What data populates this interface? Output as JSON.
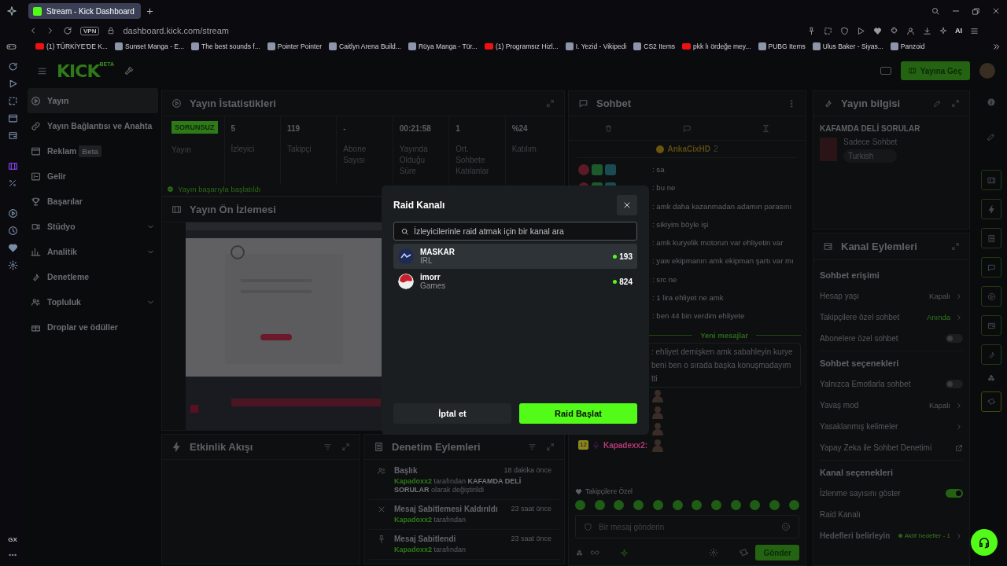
{
  "browser": {
    "tabs": [
      {
        "title": "Stream - Kick Dashboard",
        "selected": true
      }
    ],
    "vpn": "VPN",
    "url": "dashboard.kick.com/stream",
    "ai_label": "AI",
    "bookmarks": [
      {
        "kind": "video",
        "title": "(1) TÜRKİYE'DE K..."
      },
      {
        "kind": "page",
        "title": "Sunset Manga - E..."
      },
      {
        "kind": "page",
        "title": "The best sounds f..."
      },
      {
        "kind": "page",
        "title": "Pointer Pointer"
      },
      {
        "kind": "page",
        "title": "Caitlyn Arena Build..."
      },
      {
        "kind": "page",
        "title": "Rüya Manga - Tür..."
      },
      {
        "kind": "video",
        "title": "(1) Programsız Hizl..."
      },
      {
        "kind": "page",
        "title": "I. Yezid - Vikipedi"
      },
      {
        "kind": "page",
        "title": "CS2 Items"
      },
      {
        "kind": "video",
        "title": "pkk lı ördeğe mey..."
      },
      {
        "kind": "page",
        "title": "PUBG Items"
      },
      {
        "kind": "page",
        "title": "Ulus Baker - Siyas..."
      },
      {
        "kind": "page",
        "title": "Panzoid"
      }
    ],
    "gx_label": "GX"
  },
  "header": {
    "logo": "KICK",
    "logo_badge": "BETA",
    "go_live": "Yayına Geç"
  },
  "nav": {
    "items": [
      {
        "label": "Yayın",
        "selected": true,
        "expandable": false
      },
      {
        "label": "Yayın Bağlantısı ve Anahta",
        "selected": false,
        "expandable": false
      },
      {
        "label": "Reklam",
        "badge": "Beta",
        "selected": false,
        "expandable": false
      },
      {
        "label": "Gelir",
        "selected": false,
        "expandable": false
      },
      {
        "label": "Başarılar",
        "selected": false,
        "expandable": false
      },
      {
        "label": "Stüdyo",
        "selected": false,
        "expandable": true
      },
      {
        "label": "Analitik",
        "selected": false,
        "expandable": true
      },
      {
        "label": "Denetleme",
        "selected": false,
        "expandable": false
      },
      {
        "label": "Topluluk",
        "selected": false,
        "expandable": true
      },
      {
        "label": "Droplar ve ödüller",
        "selected": false,
        "expandable": false
      }
    ]
  },
  "stats": {
    "title": "Yayın İstatistikleri",
    "status": "SORUNSUZ",
    "status_label": "Yayın",
    "items": [
      {
        "value": "5",
        "label": "İzleyici"
      },
      {
        "value": "119",
        "label": "Takipçi"
      },
      {
        "value": "-",
        "label": "Abone Sayısı"
      },
      {
        "value": "00:21:58",
        "label": "Yayında Olduğu Süre"
      },
      {
        "value": "1",
        "label": "Ort. Sohbete Katılanlar"
      },
      {
        "value": "%24",
        "label": "Katılım"
      }
    ],
    "notice": "Yayın başarıyla başlatıldı"
  },
  "preview": {
    "title": "Yayın Ön İzlemesi"
  },
  "feed": {
    "title": "Etkinlik Akışı"
  },
  "audit": {
    "title": "Denetim Eylemleri",
    "entries": [
      {
        "title": "Başlık",
        "time": "18 dakika önce",
        "user": "Kapadoxx2",
        "text": "tarafından **KAFAMDA DELİ SORULAR** olarak değiştirildi"
      },
      {
        "title": "Mesaj Sabitlemesi Kaldırıldı",
        "time": "23 saat önce",
        "user": "Kapadoxx2",
        "text": "tarafından"
      },
      {
        "title": "Mesaj Sabitlendi",
        "time": "23 saat önce",
        "user": "Kapadoxx2",
        "text": "tarafından"
      }
    ]
  },
  "chat": {
    "title": "Sohbet",
    "pinned_user": "AnkaCixHD",
    "pinned_count": "2",
    "messages": [
      {
        "text": ": sa",
        "badges": true
      },
      {
        "text": ": bu ne",
        "badges": true
      },
      {
        "text": ": amk daha kazanmadan adamın parasını"
      },
      {
        "text": ": sikiyim böyle işi"
      },
      {
        "text": ": amk kuryelik motorun var ehliyetin var"
      },
      {
        "text": ": yaw ekipmanın amk ekipman şartı var mı"
      },
      {
        "text": ": src ne"
      },
      {
        "text": ": 1 lira ehliyet ne amk"
      },
      {
        "text": ": ben 44 bin verdim ehliyete"
      }
    ],
    "new_marker": "Yeni mesajlar",
    "highlight_lines": [
      ": ehliyet demişken amk sabahleyin kurye",
      "beni ben o sırada başka konuşmadayım",
      "tti"
    ],
    "emote_messages": [
      {
        "kind": "plain"
      },
      {
        "kind": "plain"
      },
      {
        "kind": "plain"
      },
      {
        "kind": "named",
        "badge": "12",
        "user": "Kapadexx2:"
      }
    ],
    "emote_label": "Takipçilere Özel",
    "placeholder": "Bir mesaj gönderin",
    "send": "Gönder"
  },
  "info": {
    "title": "Yayın bilgisi",
    "stream_title": "KAFAMDA DELİ SORULAR",
    "category": "Sadece Sohbet",
    "tag": "Turkish"
  },
  "actions": {
    "title": "Kanal Eylemleri",
    "sections": [
      {
        "title": "Sohbet erişimi",
        "rows": [
          {
            "kind": "value",
            "label": "Hesap yaşı",
            "value": "Kapalı",
            "on": false
          },
          {
            "kind": "value",
            "label": "Takipçilere özel sohbet",
            "value": "Anında",
            "on": true
          },
          {
            "kind": "toggle",
            "label": "Abonelere özel sohbet",
            "on": false
          }
        ]
      },
      {
        "title": "Sohbet seçenekleri",
        "rows": [
          {
            "kind": "toggle",
            "label": "Yalnızca Emotlarla sohbet",
            "on": false
          },
          {
            "kind": "value",
            "label": "Yavaş mod",
            "value": "Kapalı",
            "on": false
          },
          {
            "kind": "link",
            "label": "Yasaklanmış kelimeler"
          },
          {
            "kind": "external",
            "label": "Yapay Zeka ile Sohbet Denetimi"
          }
        ]
      },
      {
        "title": "Kanal seçenekleri",
        "rows": [
          {
            "kind": "toggle",
            "label": "İzlenme sayısını göster",
            "on": true
          },
          {
            "kind": "plain",
            "label": "Raid Kanalı"
          },
          {
            "kind": "goal",
            "label": "Hedefleri belirleyin",
            "value": "Aktif hedefler - 1"
          }
        ]
      }
    ]
  },
  "modal": {
    "title": "Raid Kanalı",
    "placeholder": "İzleyicilerinle raid atmak için bir kanal ara",
    "channels": [
      {
        "name": "MASKAR",
        "category": "IRL",
        "viewers": "193",
        "hovered": true
      },
      {
        "name": "imorr",
        "category": "Games",
        "viewers": "824",
        "hovered": false
      }
    ],
    "cancel": "İptal et",
    "confirm": "Raid Başlat"
  }
}
